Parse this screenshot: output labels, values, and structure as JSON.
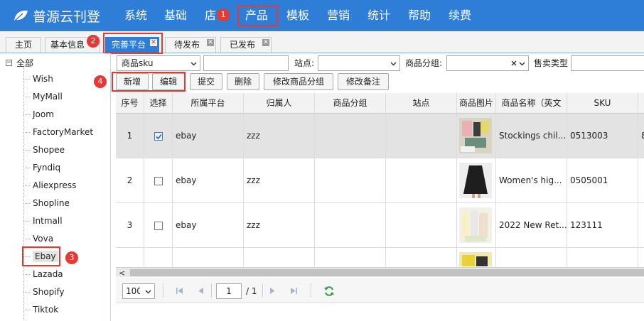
{
  "app": {
    "title": "普源云刊登"
  },
  "nav": {
    "items": [
      "系统",
      "基础",
      "店",
      "产品",
      "模板",
      "营销",
      "统计",
      "帮助",
      "续费"
    ]
  },
  "badges": [
    "1",
    "2",
    "3",
    "4"
  ],
  "tabs": [
    {
      "label": "主页"
    },
    {
      "label": "基本信息"
    },
    {
      "label": "完善平台"
    },
    {
      "label": "待发布"
    },
    {
      "label": "已发布"
    }
  ],
  "sidebar": {
    "root": "全部",
    "items": [
      "Wish",
      "MyMall",
      "Joom",
      "FactoryMarket",
      "Shopee",
      "Fyndiq",
      "Aliexpress",
      "Shopline",
      "Intmall",
      "Vova",
      "Ebay",
      "Lazada",
      "Shopify",
      "Tiktok"
    ]
  },
  "filters": {
    "sku_select": "商品sku",
    "sku_input": "",
    "site_label": "站点:",
    "site_value": "",
    "group_label": "商品分组:",
    "group_value": "",
    "sale_type_label": "售卖类型"
  },
  "actions": [
    "新增",
    "编辑",
    "提交",
    "删除",
    "修改商品分组",
    "修改备注"
  ],
  "table": {
    "headers": [
      "序号",
      "选择",
      "所属平台",
      "归属人",
      "商品分组",
      "站点",
      "商品图片",
      "商品名称（英文",
      "SKU"
    ],
    "rows": [
      {
        "no": "1",
        "checked": true,
        "platform": "ebay",
        "owner": "zzz",
        "group": "",
        "site": "",
        "name": "Stockings chil...",
        "sku": "0513003",
        "extra": "8"
      },
      {
        "no": "2",
        "checked": false,
        "platform": "ebay",
        "owner": "zzz",
        "group": "",
        "site": "",
        "name": "Women's hig...",
        "sku": "0505001",
        "extra": ""
      },
      {
        "no": "3",
        "checked": false,
        "platform": "ebay",
        "owner": "zzz",
        "group": "",
        "site": "",
        "name": "2022 New Ret...",
        "sku": "123111",
        "extra": ""
      }
    ]
  },
  "pager": {
    "page_size": "100",
    "page_input": "1",
    "page_total": "/ 1"
  },
  "colors": {
    "accent": "#2e7dd6",
    "marker": "#e53935"
  }
}
